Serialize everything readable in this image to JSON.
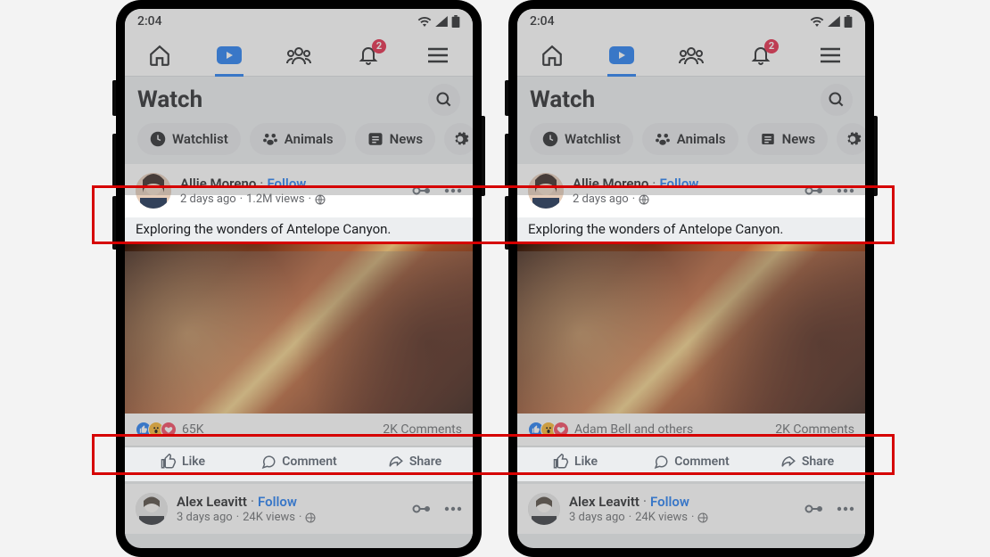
{
  "statusbar": {
    "time": "2:04"
  },
  "nav": {
    "notif_badge": "2"
  },
  "watch": {
    "title": "Watch",
    "chips": {
      "watchlist": "Watchlist",
      "animals": "Animals",
      "news": "News"
    }
  },
  "post_left": {
    "name": "Allie Moreno",
    "follow": "Follow",
    "time": "2 days ago",
    "views": "1.2M views",
    "text": "Exploring the wonders of Antelope Canyon.",
    "react_count": "65K",
    "comments": "2K Comments"
  },
  "post_right": {
    "name": "Allie Moreno",
    "follow": "Follow",
    "time": "2 days ago",
    "text": "Exploring the wonders of Antelope Canyon.",
    "react_text": "Adam Bell and others",
    "comments": "2K Comments"
  },
  "actions": {
    "like": "Like",
    "comment": "Comment",
    "share": "Share"
  },
  "post2": {
    "name": "Alex Leavitt",
    "follow": "Follow",
    "time": "3 days ago",
    "views": "24K views"
  }
}
